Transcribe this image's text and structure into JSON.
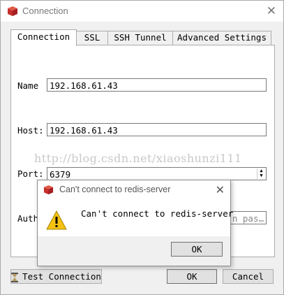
{
  "window": {
    "title": "Connection",
    "close_glyph": "✕",
    "icon": "redis-cube-icon"
  },
  "tabs": [
    {
      "label": "Connection",
      "active": true
    },
    {
      "label": "SSL",
      "active": false
    },
    {
      "label": "SSH Tunnel",
      "active": false
    },
    {
      "label": "Advanced Settings",
      "active": false
    }
  ],
  "form": {
    "name_label": "Name",
    "name_value": "192.168.61.43",
    "host_label": "Host:",
    "host_value": "192.168.61.43",
    "port_label": "Port:",
    "port_value": "6379",
    "auth_label": "Auth",
    "auth_placeholder": "n pas…"
  },
  "watermark": "http://blog.csdn.net/xiaoshunzi111",
  "buttons": {
    "test_connection": "Test Connection",
    "ok": "OK",
    "cancel": "Cancel"
  },
  "dialog": {
    "title": "Can't connect to redis-server",
    "message": "Can't connect to redis-server",
    "ok": "OK",
    "close_glyph": "✕",
    "icon": "warning-icon"
  },
  "colors": {
    "redis_red": "#c6302b",
    "warning_yellow": "#f5c211"
  }
}
